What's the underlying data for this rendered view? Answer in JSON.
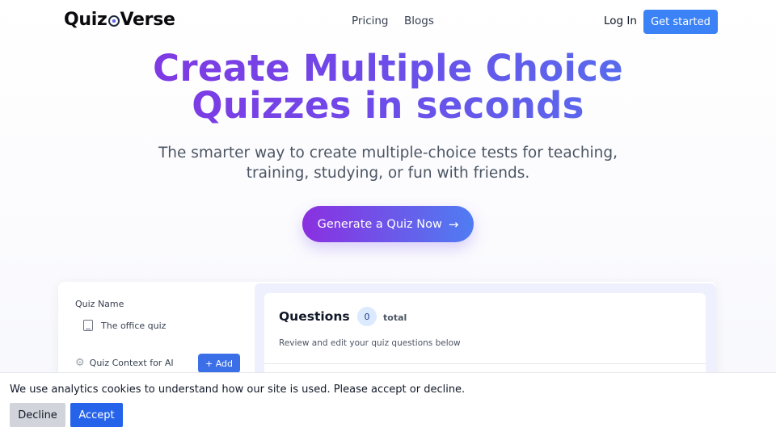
{
  "header": {
    "logo_left": "Quiz",
    "logo_right": "Verse",
    "nav": [
      {
        "label": "Pricing"
      },
      {
        "label": "Blogs"
      }
    ],
    "login_label": "Log In",
    "get_started_label": "Get started"
  },
  "hero": {
    "title_line1": "Create Multiple Choice",
    "title_line2": "Quizzes in seconds",
    "subtitle_line1": "The smarter way to create multiple-choice tests for teaching,",
    "subtitle_line2": "training, studying, or fun with friends.",
    "cta_label": "Generate a Quiz Now",
    "cta_icon": "arrow-right-icon",
    "gradient_start": "#8b2fe0",
    "gradient_end": "#4a7ff0"
  },
  "preview": {
    "quiz_name_label": "Quiz Name",
    "quiz_name_value": "The office quiz",
    "context_label": "Quiz Context for AI",
    "add_label": "+ Add",
    "questions_title": "Questions",
    "questions_count": "0",
    "questions_total_label": "total",
    "questions_description": "Review and edit your quiz questions below"
  },
  "cookie": {
    "message": "We use analytics cookies to understand how our site is used. Please accept or decline.",
    "decline_label": "Decline",
    "accept_label": "Accept"
  },
  "colors": {
    "accent": "#3b82f6",
    "accept": "#2563eb"
  }
}
